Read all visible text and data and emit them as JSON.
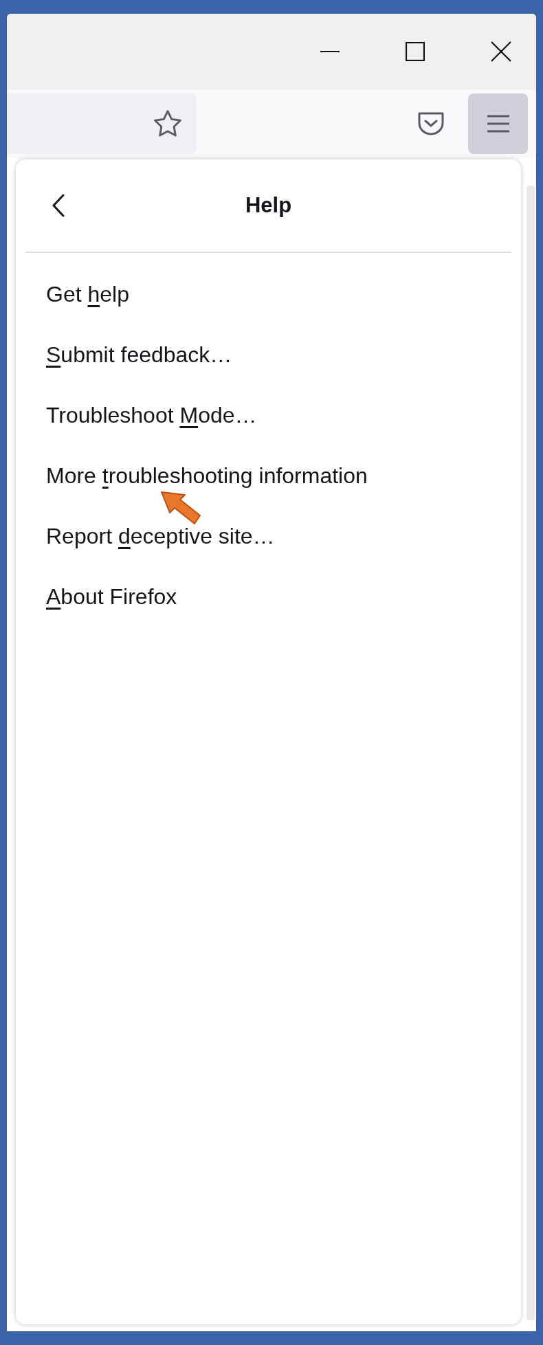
{
  "toolbar": {
    "menu_button": {
      "selected": true
    }
  },
  "panel": {
    "title": "Help",
    "items": [
      {
        "before": "Get ",
        "access_key": "h",
        "after": "elp"
      },
      {
        "access_key": "S",
        "after": "ubmit feedback…"
      },
      {
        "before": "Troubleshoot ",
        "access_key": "M",
        "after": "ode…"
      },
      {
        "before": "More ",
        "access_key": "t",
        "after": "roubleshooting information"
      },
      {
        "before": "Report ",
        "access_key": "d",
        "after": "eceptive site…"
      },
      {
        "access_key": "A",
        "after": "bout Firefox"
      }
    ]
  }
}
